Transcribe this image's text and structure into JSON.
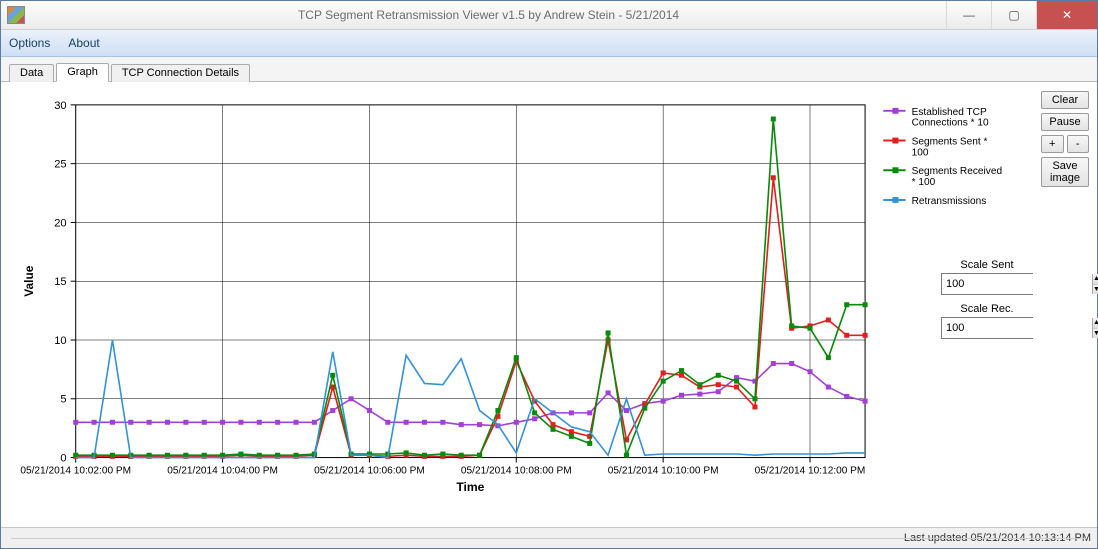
{
  "window": {
    "title": "TCP Segment Retransmission Viewer v1.5 by Andrew Stein - 5/21/2014"
  },
  "menu": {
    "options": "Options",
    "about": "About"
  },
  "tabs": {
    "data": "Data",
    "graph": "Graph",
    "details": "TCP Connection Details",
    "active": "graph"
  },
  "buttons": {
    "clear": "Clear",
    "pause": "Pause",
    "plus": "+",
    "minus": "-",
    "save": "Save image"
  },
  "scale": {
    "sent_label": "Scale Sent",
    "sent_value": "100",
    "rec_label": "Scale Rec.",
    "rec_value": "100"
  },
  "status": {
    "text": "Last updated 05/21/2014 10:13:14 PM"
  },
  "chart": {
    "xlabel": "Time",
    "ylabel": "Value",
    "legend": {
      "s1": "Established TCP Connections * 10",
      "s2": "Segments Sent * 100",
      "s3": "Segments Received * 100",
      "s4": "Retransmissions"
    },
    "xticks": [
      "05/21/2014 10:02:00 PM",
      "05/21/2014 10:04:00 PM",
      "05/21/2014 10:06:00 PM",
      "05/21/2014 10:08:00 PM",
      "05/21/2014 10:10:00 PM",
      "05/21/2014 10:12:00 PM"
    ],
    "colors": {
      "conn": "#a23fd6",
      "sent": "#e02020",
      "recv": "#0a8a0a",
      "retx": "#3592d4"
    }
  },
  "chart_data": {
    "type": "line",
    "title": "",
    "xlabel": "Time",
    "ylabel": "Value",
    "ylim": [
      0,
      30
    ],
    "x_range_minutes": [
      "10:02:00 PM",
      "10:13:00 PM"
    ],
    "x": [
      0,
      1,
      2,
      3,
      4,
      5,
      6,
      7,
      8,
      9,
      10,
      11,
      12,
      13,
      14,
      15,
      16,
      17,
      18,
      19,
      20,
      21,
      22,
      23,
      24,
      25,
      26,
      27,
      28,
      29,
      30,
      31,
      32,
      33,
      34,
      35,
      36,
      37,
      38,
      39,
      40,
      41,
      42,
      43
    ],
    "series": [
      {
        "name": "Established TCP Connections * 10",
        "color": "#a23fd6",
        "marker": "square",
        "values": [
          3,
          3,
          3,
          3,
          3,
          3,
          3,
          3,
          3,
          3,
          3,
          3,
          3,
          3,
          4,
          5,
          4,
          3,
          3,
          3,
          3,
          2.8,
          2.8,
          2.7,
          3,
          3.3,
          3.8,
          3.8,
          3.8,
          5.5,
          4,
          4.6,
          4.8,
          5.3,
          5.4,
          5.6,
          6.8,
          6.5,
          8,
          8,
          7.3,
          6,
          5.2,
          4.8
        ]
      },
      {
        "name": "Segments Sent * 100",
        "color": "#e02020",
        "marker": "square",
        "values": [
          0.1,
          0.1,
          0.1,
          0.1,
          0.1,
          0.1,
          0.1,
          0.1,
          0.1,
          0.2,
          0.1,
          0.1,
          0.1,
          0.2,
          6,
          0.2,
          0.2,
          0.1,
          0.2,
          0.1,
          0.1,
          0.1,
          0.2,
          3.5,
          8.2,
          4.8,
          2.8,
          2.2,
          1.8,
          10,
          1.5,
          4.5,
          7.2,
          7,
          6,
          6.2,
          6,
          4.3,
          23.8,
          11,
          11.2,
          11.7,
          10.4,
          10.4
        ]
      },
      {
        "name": "Segments Received * 100",
        "color": "#0a8a0a",
        "marker": "square",
        "values": [
          0.2,
          0.2,
          0.2,
          0.2,
          0.2,
          0.2,
          0.2,
          0.2,
          0.2,
          0.3,
          0.2,
          0.2,
          0.2,
          0.3,
          7,
          0.3,
          0.3,
          0.3,
          0.4,
          0.2,
          0.3,
          0.2,
          0.2,
          4,
          8.5,
          3.8,
          2.4,
          1.8,
          1.2,
          10.6,
          0.2,
          4.2,
          6.5,
          7.4,
          6.2,
          7,
          6.5,
          5,
          28.8,
          11.2,
          11,
          8.5,
          13,
          13
        ]
      },
      {
        "name": "Retransmissions",
        "color": "#3592d4",
        "marker": "none",
        "values": [
          0,
          0,
          10,
          0,
          0,
          0,
          0,
          0,
          0,
          0,
          0,
          0,
          0,
          0,
          9,
          0.2,
          0.2,
          0,
          8.7,
          6.3,
          6.2,
          8.4,
          4,
          2.8,
          0.4,
          5,
          3.8,
          2.6,
          2.2,
          0.2,
          5,
          0.2,
          0.3,
          0.3,
          0.3,
          0.3,
          0.3,
          0.2,
          0.3,
          0.3,
          0.3,
          0.3,
          0.4,
          0.4
        ]
      }
    ]
  }
}
